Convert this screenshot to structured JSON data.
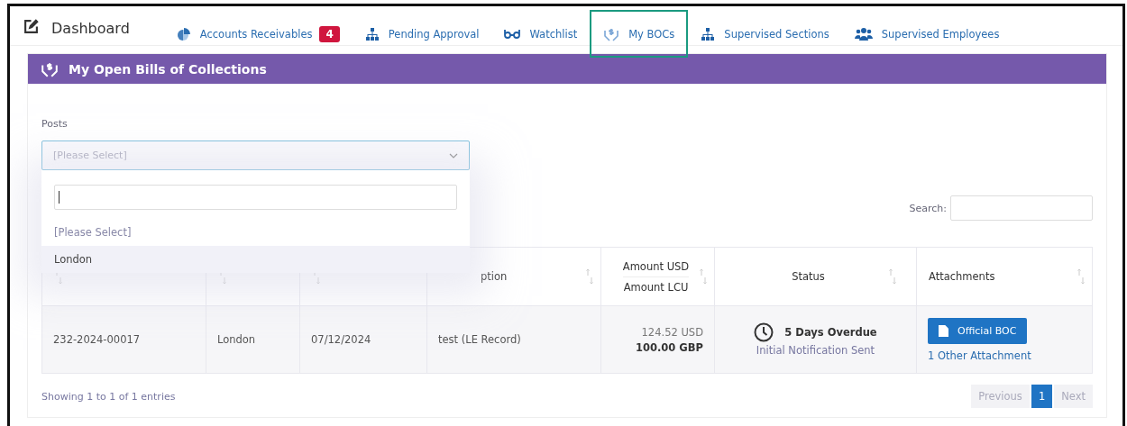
{
  "header": {
    "title": "Dashboard"
  },
  "tabs": [
    {
      "label": "Accounts Receivables",
      "badge": "4",
      "selected": false
    },
    {
      "label": "Pending Approval",
      "selected": false
    },
    {
      "label": "Watchlist",
      "selected": false
    },
    {
      "label": "My BOCs",
      "selected": true
    },
    {
      "label": "Supervised Sections",
      "selected": false
    },
    {
      "label": "Supervised Employees",
      "selected": false
    }
  ],
  "panel": {
    "title": "My Open Bills of Collections",
    "posts_filter": {
      "label": "Posts",
      "placeholder": "[Please Select]",
      "expanded": true,
      "options": [
        {
          "label": "[Please Select]",
          "selected": false
        },
        {
          "label": "London",
          "selected": true
        }
      ]
    },
    "search": {
      "label": "Search:"
    },
    "table": {
      "columns": [
        {},
        {},
        {},
        {
          "label": "ption"
        },
        {
          "label": "Amount USD",
          "label_2": "Amount LCU"
        },
        {
          "label": "Status"
        },
        {
          "label": "Attachments"
        }
      ],
      "rows": [
        {
          "id": "232-2024-00017",
          "post": "London",
          "bill_date": "07/12/2024",
          "description": "test (LE Record)",
          "amount_usd": "124.52 USD",
          "amount_lcu": "100.00 GBP",
          "status": "5 Days Overdue",
          "status_note": "Initial Notification Sent",
          "attachment_button": "Official BOC",
          "attachment_link": "1 Other Attachment"
        }
      ]
    },
    "info": "Showing 1 to 1 of 1 entries",
    "pagination": [
      {
        "label": "Previous",
        "kind": "prev",
        "disabled": true,
        "selected": false
      },
      {
        "label": "1",
        "kind": "page",
        "disabled": false,
        "selected": true
      },
      {
        "label": "Next",
        "kind": "next",
        "disabled": true,
        "selected": false
      }
    ]
  }
}
